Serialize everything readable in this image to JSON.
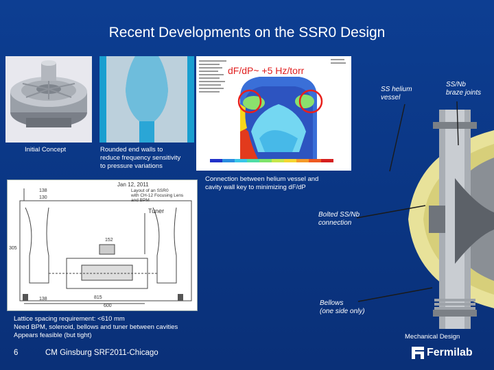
{
  "title": "Recent Developments on the SSR0 Design",
  "captions": {
    "initial_concept": "Initial Concept",
    "rounded_walls": [
      "Rounded end walls to",
      "reduce frequency sensitivity",
      "to pressure variations"
    ],
    "dfdp_overlay": "dF/dP~ +5 Hz/torr",
    "ss_helium_vessel": [
      "SS helium",
      "vessel"
    ],
    "ss_nb_braze": [
      "SS/Nb",
      "braze joints"
    ],
    "connection_note": [
      "Connection between helium vessel and",
      "cavity wall key to minimizing dF/dP"
    ],
    "bolted": [
      "Bolted SS/Nb",
      "connection"
    ],
    "bellows": [
      "Bellows",
      "(one side only)"
    ],
    "lattice": [
      "Lattice spacing requirement:  <610 mm",
      "Need BPM, solenoid, bellows and tuner between cavities",
      "Appears feasible (but tight)"
    ],
    "mechanical_design": "Mechanical Design"
  },
  "drawing": {
    "date": "Jan 12, 2011",
    "layout_note": [
      "Layout of an SSR0",
      "with CH-12 Focusing Lens",
      "and BPM"
    ],
    "tuner": "Tuner",
    "dims": [
      "138",
      "130",
      "305",
      "152",
      "815",
      "600",
      "138"
    ]
  },
  "footer": {
    "page_number": "6",
    "credit": "CM Ginsburg SRF2011-Chicago",
    "logo": "Fermilab"
  },
  "colors": {
    "background": "#0c3a8c",
    "accent_red": "#e8201c",
    "overlay_text": "#e02020"
  }
}
